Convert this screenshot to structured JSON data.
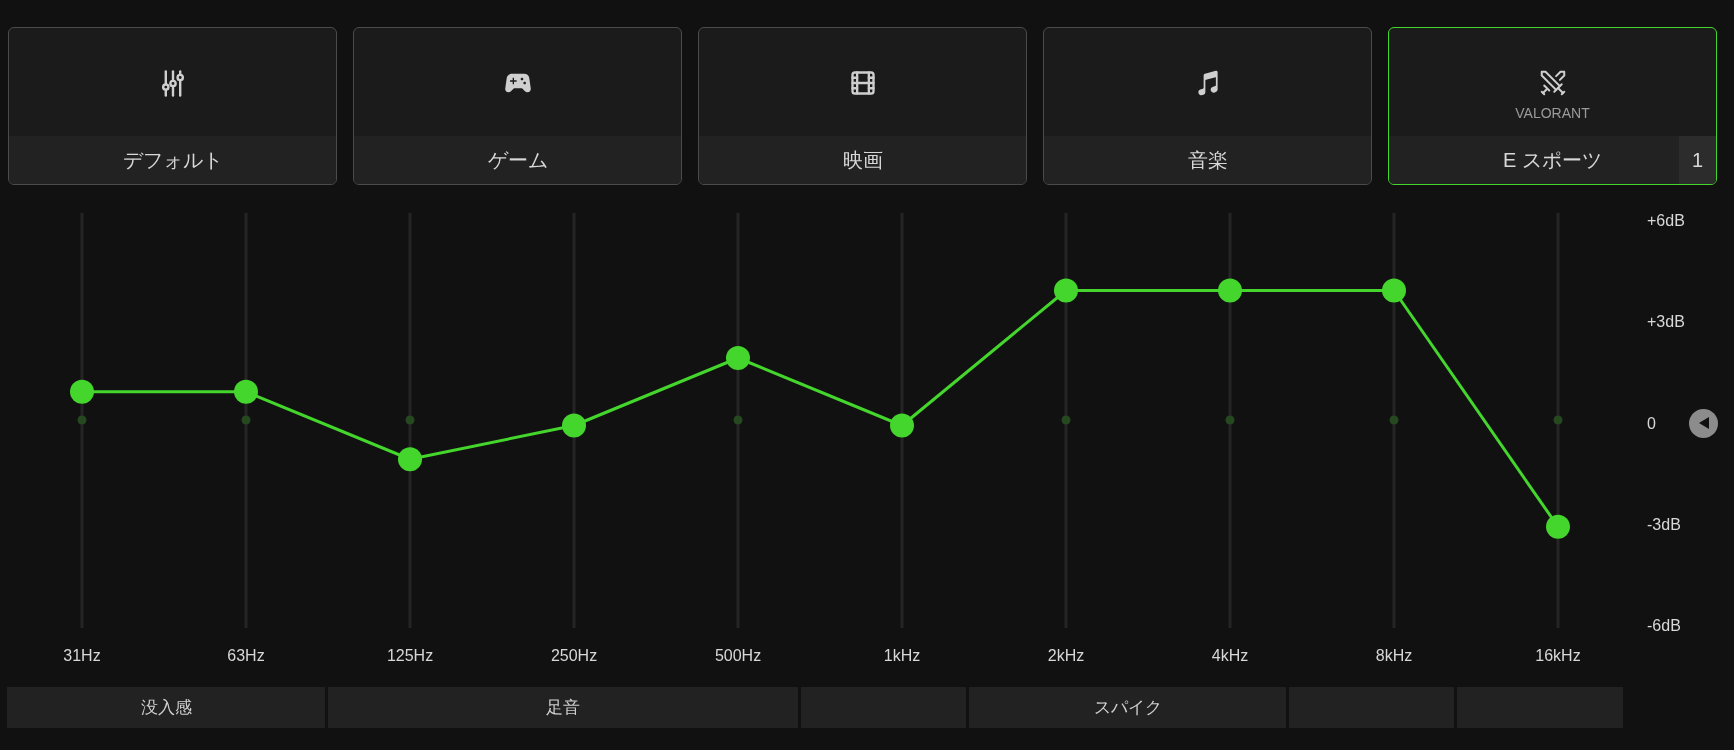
{
  "presets": [
    {
      "label": "デフォルト",
      "kind": "default",
      "selected": false
    },
    {
      "label": "ゲーム",
      "kind": "game",
      "selected": false
    },
    {
      "label": "映画",
      "kind": "movie",
      "selected": false
    },
    {
      "label": "音楽",
      "kind": "music",
      "selected": false
    },
    {
      "label": "E スポーツ",
      "kind": "esports",
      "subtitle": "VALORANT",
      "badge": "1",
      "selected": true
    }
  ],
  "equalizer": {
    "chart_data": {
      "type": "line",
      "categories": [
        "31Hz",
        "63Hz",
        "125Hz",
        "250Hz",
        "500Hz",
        "1kHz",
        "2kHz",
        "4kHz",
        "8kHz",
        "16kHz"
      ],
      "series": [
        {
          "color": "#44d62c",
          "marker": "circle",
          "values": [
            1,
            1,
            -1,
            0,
            2,
            0,
            4,
            4,
            4,
            -3
          ]
        }
      ],
      "ylim": [
        -6,
        6
      ],
      "yticks": [
        {
          "value": -6,
          "label": "-6dB"
        },
        {
          "value": -3,
          "label": "-3dB"
        },
        0,
        {
          "value": 3,
          "label": "+3dB"
        },
        {
          "value": 6,
          "label": "+6dB"
        }
      ]
    },
    "band_groups": [
      {
        "kind": "labeled",
        "label": "没入感"
      },
      {
        "kind": "labeled",
        "label": "足音"
      },
      {
        "kind": "blank"
      },
      {
        "kind": "labeled",
        "label": "スパイク"
      },
      {
        "kind": "blank"
      },
      {
        "kind": "blank"
      }
    ]
  }
}
